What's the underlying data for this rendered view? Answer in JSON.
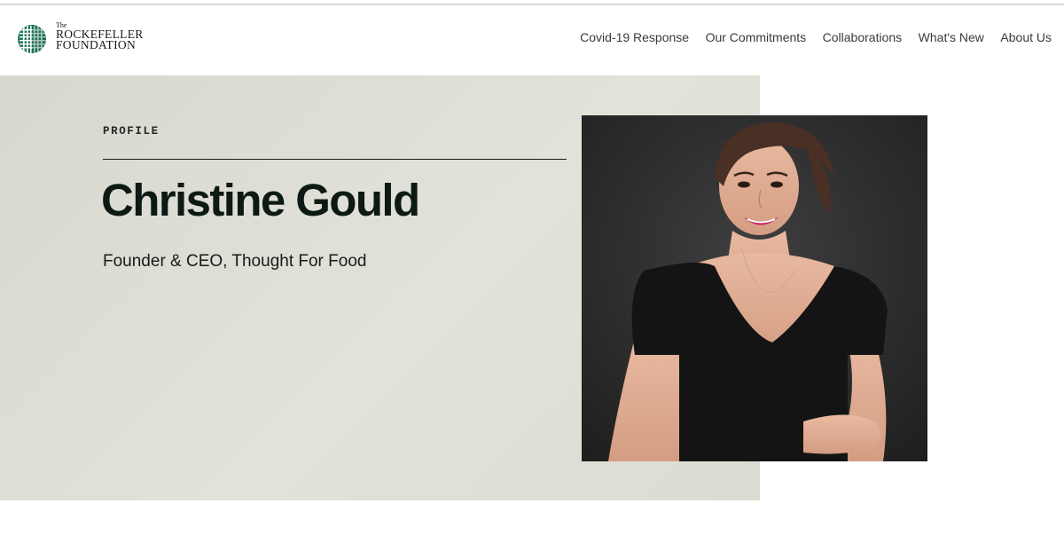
{
  "brand": {
    "the": "The",
    "line1": "ROCKEFELLER",
    "line2": "FOUNDATION",
    "accent_color": "#1f7a5c",
    "icon": "globe-grid-icon"
  },
  "nav": {
    "items": [
      {
        "label": "Covid-19 Response"
      },
      {
        "label": "Our Commitments"
      },
      {
        "label": "Collaborations"
      },
      {
        "label": "What's New"
      },
      {
        "label": "About Us"
      }
    ]
  },
  "profile": {
    "eyebrow": "PROFILE",
    "name": "Christine Gould",
    "title": "Founder & CEO, Thought For Food",
    "portrait_icon": "portrait-photo"
  },
  "colors": {
    "hero_background": "#dddcd3",
    "text_dark": "#0d1a14"
  }
}
